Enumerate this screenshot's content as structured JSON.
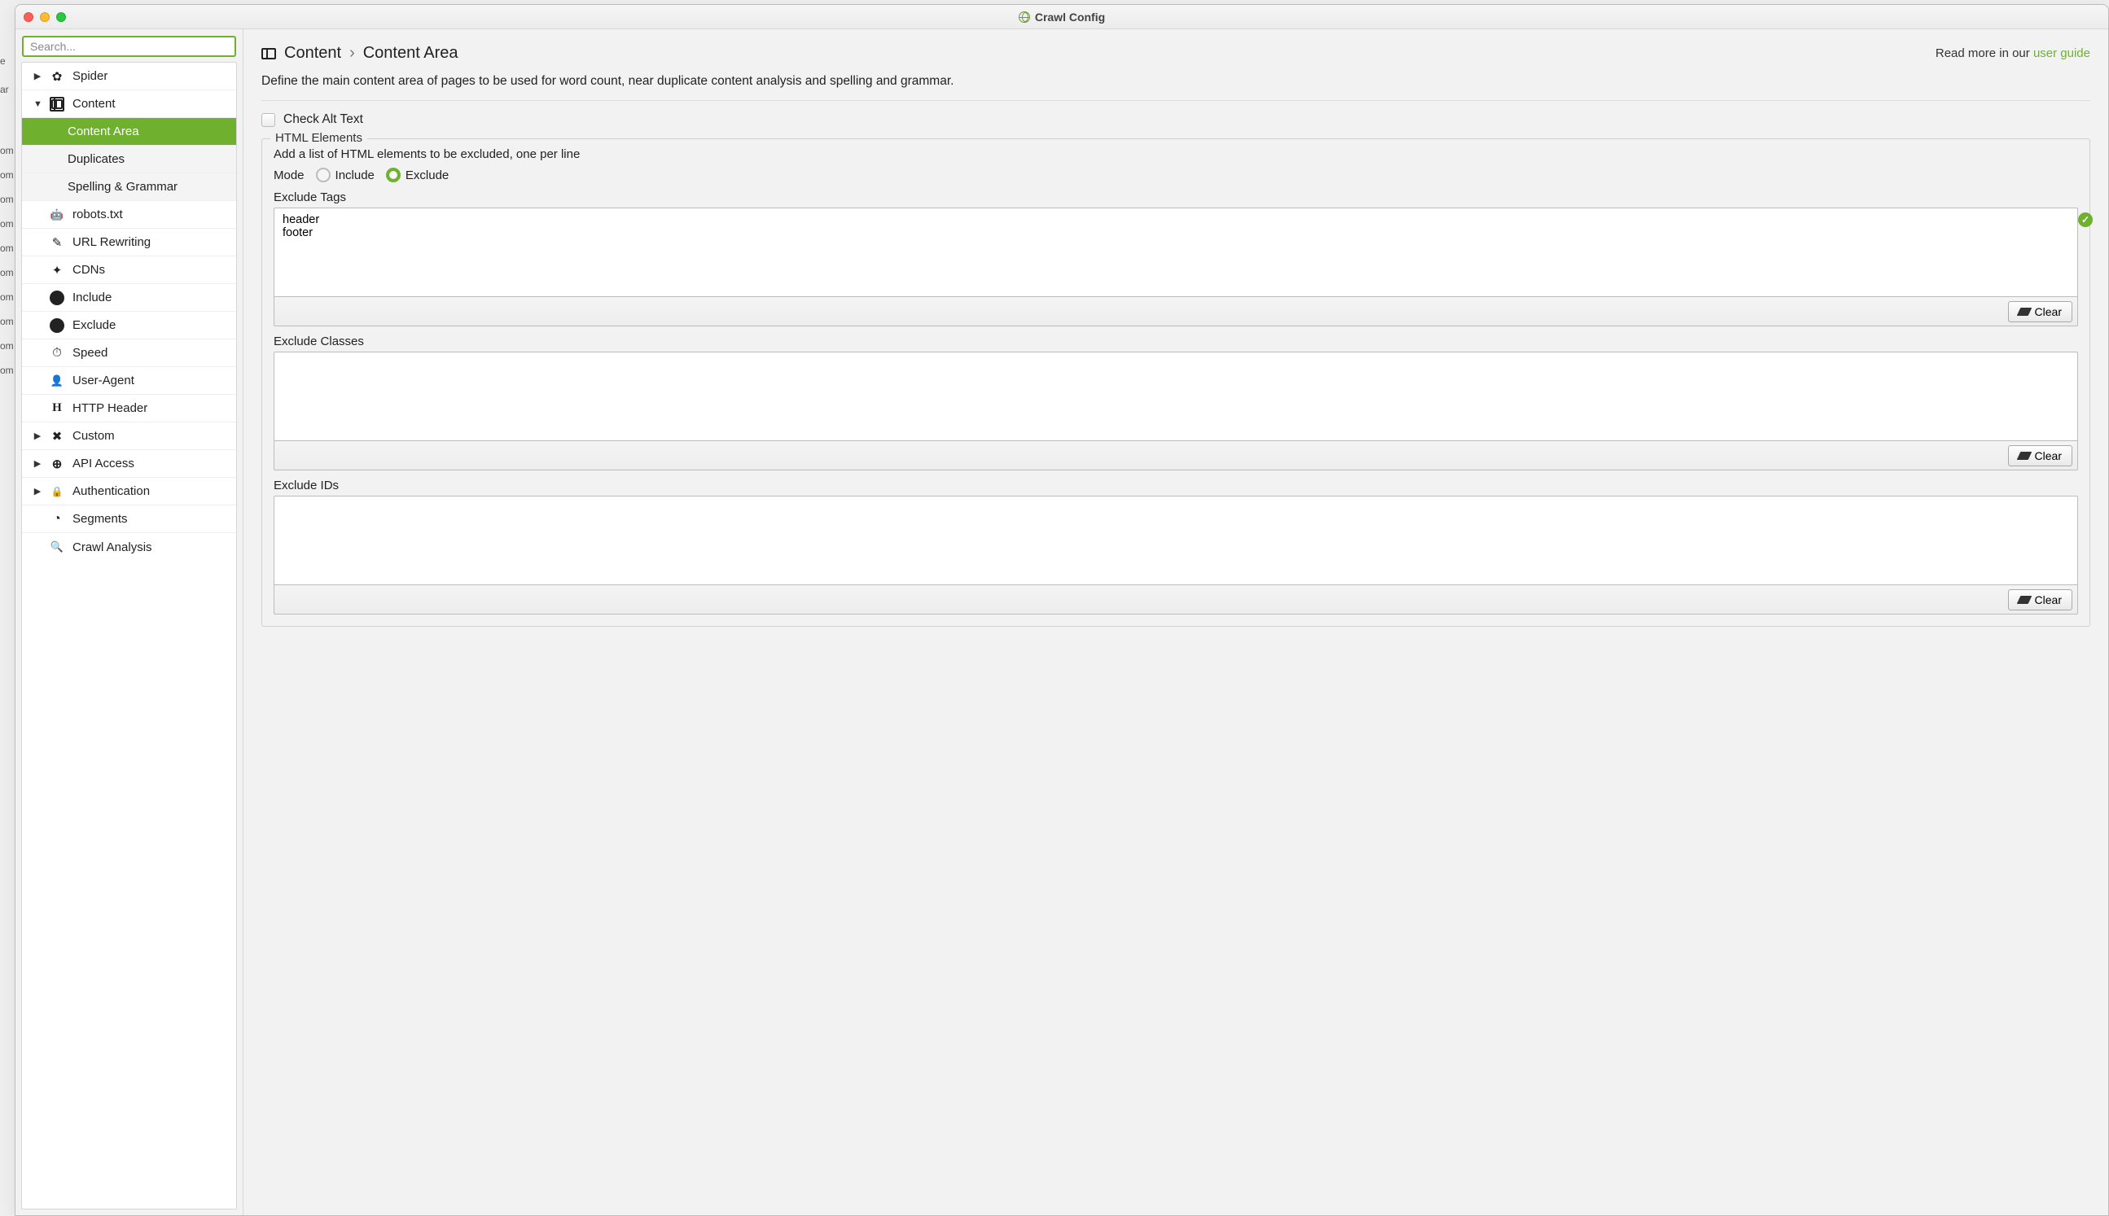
{
  "window": {
    "title": "Crawl Config"
  },
  "sidebar": {
    "search_placeholder": "Search...",
    "items": [
      {
        "label": "Spider",
        "icon": "gear",
        "arrow": "right",
        "sub": false
      },
      {
        "label": "Content",
        "icon": "layout",
        "arrow": "down",
        "sub": false
      },
      {
        "label": "Content Area",
        "icon": "",
        "arrow": "",
        "sub": true,
        "active": true
      },
      {
        "label": "Duplicates",
        "icon": "",
        "arrow": "",
        "sub": true
      },
      {
        "label": "Spelling & Grammar",
        "icon": "",
        "arrow": "",
        "sub": true
      },
      {
        "label": "robots.txt",
        "icon": "robot",
        "arrow": "",
        "sub": false
      },
      {
        "label": "URL Rewriting",
        "icon": "edit",
        "arrow": "",
        "sub": false
      },
      {
        "label": "CDNs",
        "icon": "cdn",
        "arrow": "",
        "sub": false
      },
      {
        "label": "Include",
        "icon": "check",
        "arrow": "",
        "sub": false
      },
      {
        "label": "Exclude",
        "icon": "x",
        "arrow": "",
        "sub": false
      },
      {
        "label": "Speed",
        "icon": "speed",
        "arrow": "",
        "sub": false
      },
      {
        "label": "User-Agent",
        "icon": "ua",
        "arrow": "",
        "sub": false
      },
      {
        "label": "HTTP Header",
        "icon": "http",
        "arrow": "",
        "sub": false
      },
      {
        "label": "Custom",
        "icon": "tools",
        "arrow": "right",
        "sub": false
      },
      {
        "label": "API Access",
        "icon": "globe2",
        "arrow": "right",
        "sub": false
      },
      {
        "label": "Authentication",
        "icon": "auth",
        "arrow": "right",
        "sub": false
      },
      {
        "label": "Segments",
        "icon": "pie",
        "arrow": "",
        "sub": false
      },
      {
        "label": "Crawl Analysis",
        "icon": "search",
        "arrow": "",
        "sub": false
      }
    ]
  },
  "main": {
    "breadcrumb": {
      "section": "Content",
      "page": "Content Area",
      "sep": "›"
    },
    "read_more_prefix": "Read more in our ",
    "read_more_link": "user guide",
    "description": "Define the main content area of pages to be used for word count, near duplicate content analysis and spelling and grammar.",
    "check_alt_text": "Check Alt Text",
    "html_elements": {
      "legend": "HTML Elements",
      "hint": "Add a list of HTML elements to be excluded, one per line",
      "mode_label": "Mode",
      "mode_include": "Include",
      "mode_exclude": "Exclude",
      "mode_value": "Exclude",
      "exclude_tags_label": "Exclude Tags",
      "exclude_tags_value": "header\nfooter",
      "exclude_classes_label": "Exclude Classes",
      "exclude_classes_value": "",
      "exclude_ids_label": "Exclude IDs",
      "exclude_ids_value": "",
      "clear_label": "Clear"
    }
  }
}
